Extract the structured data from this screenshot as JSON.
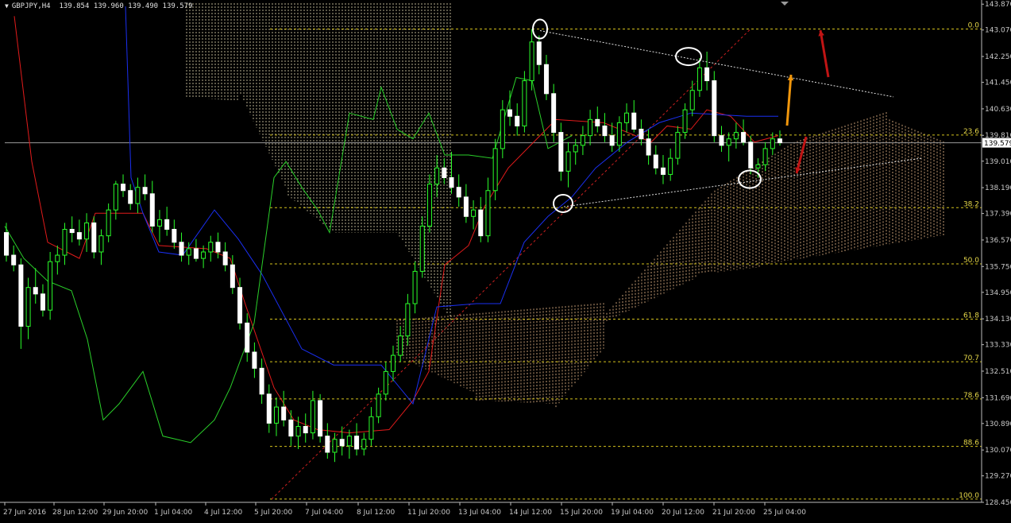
{
  "header": {
    "symbol": "GBPJPY,H4",
    "open": "139.854",
    "high": "139.960",
    "low": "139.490",
    "close": "139.579"
  },
  "chart_data": {
    "type": "candlestick",
    "title": "GBPJPY,H4",
    "ylim": [
      128.45,
      143.9
    ],
    "y_ticks": [
      "143.870",
      "143.070",
      "142.250",
      "141.450",
      "140.630",
      "139.810",
      "139.010",
      "138.190",
      "137.390",
      "136.570",
      "135.750",
      "134.950",
      "134.130",
      "133.330",
      "132.510",
      "131.690",
      "130.890",
      "130.070",
      "129.270",
      "128.450"
    ],
    "current_price": "139.579",
    "x_ticks": [
      "27 Jun 2016",
      "28 Jun 12:00",
      "29 Jun 20:00",
      "1 Jul 04:00",
      "4 Jul 12:00",
      "5 Jul 20:00",
      "7 Jul 04:00",
      "8 Jul 12:00",
      "11 Jul 20:00",
      "13 Jul 04:00",
      "14 Jul 12:00",
      "15 Jul 20:00",
      "19 Jul 04:00",
      "20 Jul 12:00",
      "21 Jul 20:00",
      "25 Jul 04:00"
    ],
    "fib_levels": [
      {
        "label": "0.0",
        "price": 143.1
      },
      {
        "label": "23.6",
        "price": 139.82
      },
      {
        "label": "38.2",
        "price": 137.57
      },
      {
        "label": "50.0",
        "price": 135.83
      },
      {
        "label": "61.8",
        "price": 134.12
      },
      {
        "label": "70.7",
        "price": 132.8
      },
      {
        "label": "78.6",
        "price": 131.65
      },
      {
        "label": "88.6",
        "price": 130.18
      },
      {
        "label": "100.0",
        "price": 128.55
      }
    ],
    "candles": [
      [
        136.8,
        137.1,
        135.9,
        136.1
      ],
      [
        136.1,
        136.4,
        135.6,
        135.8
      ],
      [
        135.8,
        136.0,
        133.2,
        133.9
      ],
      [
        133.9,
        135.4,
        133.5,
        135.1
      ],
      [
        135.1,
        135.7,
        134.6,
        134.9
      ],
      [
        134.9,
        135.2,
        134.2,
        134.4
      ],
      [
        134.4,
        136.2,
        134.1,
        135.9
      ],
      [
        135.9,
        136.4,
        135.5,
        136.1
      ],
      [
        136.1,
        137.1,
        135.8,
        136.9
      ],
      [
        136.9,
        137.3,
        136.5,
        136.8
      ],
      [
        136.8,
        137.2,
        136.4,
        136.6
      ],
      [
        136.6,
        137.4,
        136.2,
        137.1
      ],
      [
        137.1,
        137.3,
        136.0,
        136.2
      ],
      [
        136.2,
        136.9,
        135.8,
        136.7
      ],
      [
        136.7,
        137.7,
        136.5,
        137.5
      ],
      [
        137.5,
        138.4,
        137.2,
        138.3
      ],
      [
        138.3,
        138.6,
        137.9,
        138.1
      ],
      [
        138.1,
        138.3,
        137.5,
        137.7
      ],
      [
        137.7,
        138.5,
        137.4,
        138.2
      ],
      [
        138.2,
        138.6,
        137.8,
        138.0
      ],
      [
        138.0,
        138.4,
        136.8,
        137.0
      ],
      [
        137.0,
        137.5,
        136.5,
        137.2
      ],
      [
        137.2,
        137.6,
        136.7,
        136.9
      ],
      [
        136.9,
        137.2,
        136.3,
        136.5
      ],
      [
        136.5,
        136.8,
        135.9,
        136.1
      ],
      [
        136.1,
        136.5,
        135.8,
        136.3
      ],
      [
        136.3,
        136.6,
        135.9,
        136.0
      ],
      [
        136.0,
        136.4,
        135.7,
        136.2
      ],
      [
        136.2,
        136.7,
        135.9,
        136.5
      ],
      [
        136.5,
        136.8,
        136.0,
        136.2
      ],
      [
        136.2,
        136.5,
        135.6,
        135.8
      ],
      [
        135.8,
        136.1,
        134.9,
        135.1
      ],
      [
        135.1,
        135.4,
        133.8,
        134.0
      ],
      [
        134.0,
        134.3,
        132.8,
        133.1
      ],
      [
        133.1,
        133.4,
        132.3,
        132.6
      ],
      [
        132.6,
        132.9,
        131.5,
        131.8
      ],
      [
        131.8,
        132.1,
        130.6,
        130.9
      ],
      [
        130.9,
        131.7,
        130.5,
        131.4
      ],
      [
        131.4,
        131.9,
        130.8,
        131.0
      ],
      [
        131.0,
        131.3,
        130.2,
        130.5
      ],
      [
        130.5,
        131.1,
        130.1,
        130.8
      ],
      [
        130.8,
        131.2,
        130.3,
        130.6
      ],
      [
        130.6,
        131.9,
        130.4,
        131.6
      ],
      [
        131.6,
        131.8,
        130.3,
        130.5
      ],
      [
        130.5,
        130.9,
        129.8,
        130.0
      ],
      [
        130.0,
        130.6,
        129.7,
        130.4
      ],
      [
        130.4,
        130.8,
        129.9,
        130.2
      ],
      [
        130.2,
        130.7,
        129.8,
        130.5
      ],
      [
        130.5,
        130.9,
        129.9,
        130.1
      ],
      [
        130.1,
        130.6,
        129.9,
        130.4
      ],
      [
        130.4,
        131.4,
        130.2,
        131.1
      ],
      [
        131.1,
        132.0,
        130.9,
        131.8
      ],
      [
        131.8,
        132.8,
        131.6,
        132.5
      ],
      [
        132.5,
        133.3,
        132.2,
        133.0
      ],
      [
        133.0,
        133.9,
        132.8,
        133.6
      ],
      [
        133.6,
        134.9,
        133.3,
        134.6
      ],
      [
        134.6,
        135.9,
        134.3,
        135.6
      ],
      [
        135.6,
        137.3,
        135.4,
        137.0
      ],
      [
        137.0,
        138.6,
        136.8,
        138.3
      ],
      [
        138.3,
        139.2,
        137.9,
        138.8
      ],
      [
        138.8,
        139.1,
        138.3,
        138.5
      ],
      [
        138.5,
        139.3,
        138.0,
        138.2
      ],
      [
        138.2,
        138.6,
        137.6,
        137.9
      ],
      [
        137.9,
        138.3,
        137.1,
        137.3
      ],
      [
        137.3,
        137.8,
        136.9,
        137.5
      ],
      [
        137.5,
        137.9,
        136.5,
        136.7
      ],
      [
        136.7,
        138.5,
        136.5,
        138.1
      ],
      [
        138.1,
        139.7,
        137.8,
        139.4
      ],
      [
        139.4,
        140.9,
        139.1,
        140.6
      ],
      [
        140.6,
        141.2,
        140.1,
        140.4
      ],
      [
        140.4,
        140.8,
        139.8,
        140.1
      ],
      [
        140.1,
        141.8,
        139.9,
        141.5
      ],
      [
        141.5,
        143.1,
        141.2,
        142.7
      ],
      [
        142.7,
        142.9,
        141.7,
        142.0
      ],
      [
        142.0,
        142.3,
        140.9,
        141.1
      ],
      [
        141.1,
        141.4,
        139.6,
        139.9
      ],
      [
        139.9,
        140.2,
        138.4,
        138.7
      ],
      [
        138.7,
        139.6,
        138.2,
        139.3
      ],
      [
        139.3,
        139.7,
        138.9,
        139.5
      ],
      [
        139.5,
        140.1,
        139.2,
        139.8
      ],
      [
        139.8,
        140.6,
        139.5,
        140.3
      ],
      [
        140.3,
        140.7,
        139.9,
        140.1
      ],
      [
        140.1,
        140.5,
        139.6,
        139.8
      ],
      [
        139.8,
        140.2,
        139.3,
        139.5
      ],
      [
        139.5,
        140.4,
        139.3,
        140.2
      ],
      [
        140.2,
        140.8,
        139.9,
        140.5
      ],
      [
        140.5,
        140.9,
        139.9,
        140.0
      ],
      [
        140.0,
        140.3,
        139.5,
        139.7
      ],
      [
        139.7,
        140.0,
        138.9,
        139.2
      ],
      [
        139.2,
        139.5,
        138.6,
        138.8
      ],
      [
        138.8,
        139.2,
        138.3,
        138.6
      ],
      [
        138.6,
        139.4,
        138.4,
        139.1
      ],
      [
        139.1,
        140.1,
        138.9,
        139.9
      ],
      [
        139.9,
        140.8,
        139.7,
        140.6
      ],
      [
        140.6,
        141.5,
        140.4,
        141.2
      ],
      [
        141.2,
        142.2,
        141.0,
        141.9
      ],
      [
        141.9,
        142.4,
        141.2,
        141.5
      ],
      [
        141.5,
        141.8,
        139.6,
        139.8
      ],
      [
        139.8,
        140.1,
        139.3,
        139.5
      ],
      [
        139.5,
        139.9,
        139.0,
        139.7
      ],
      [
        139.7,
        140.2,
        139.4,
        139.9
      ],
      [
        139.9,
        140.3,
        139.5,
        139.6
      ],
      [
        139.6,
        139.8,
        138.6,
        138.8
      ],
      [
        138.8,
        139.1,
        138.5,
        138.9
      ],
      [
        138.9,
        139.6,
        138.7,
        139.4
      ],
      [
        139.4,
        139.9,
        139.2,
        139.7
      ],
      [
        139.7,
        139.96,
        139.49,
        139.58
      ]
    ]
  }
}
